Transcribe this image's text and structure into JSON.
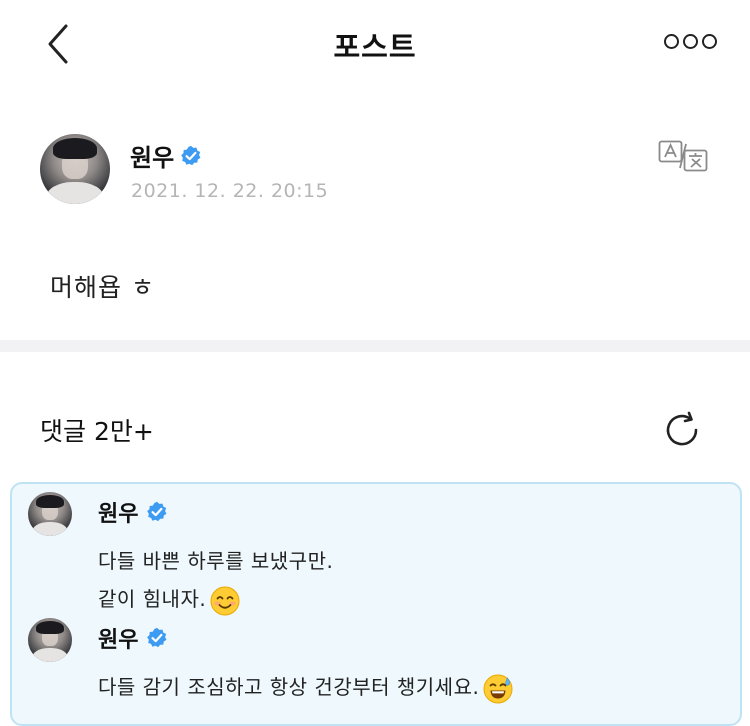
{
  "header": {
    "title": "포스트",
    "back_icon": "chevron-left-icon",
    "more_icon": "more-horizontal-icon"
  },
  "post": {
    "author": "원우",
    "verified": true,
    "timestamp": "2021. 12. 22. 20:15",
    "text": "머해욥 ㅎ",
    "translate_icon": "translate-icon"
  },
  "comments": {
    "label": "댓글 2만+",
    "refresh_icon": "refresh-icon"
  },
  "replies": [
    {
      "author": "원우",
      "lines": [
        "다들 바쁜 하루를 보냈구만.",
        "같이 힘내자."
      ],
      "emoji": "smiling-face-emoji"
    },
    {
      "author": "원우",
      "lines": [
        "다들 감기 조심하고 항상 건강부터 챙기세요."
      ],
      "emoji": "grinning-sweat-emoji"
    }
  ],
  "colors": {
    "verified": "#3d9bf2",
    "reply_background": "#eef8fd",
    "reply_border": "#bfe3f5",
    "timestamp": "#b5b5b5"
  }
}
